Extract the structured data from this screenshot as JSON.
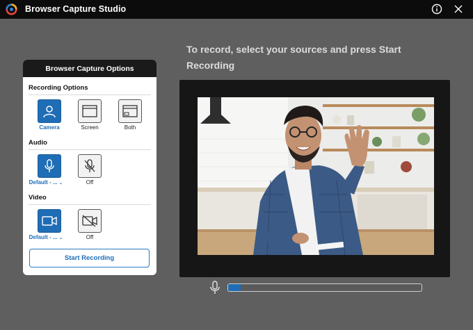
{
  "window": {
    "title": "Browser Capture Studio",
    "icons": {
      "logo": "app-logo-icon",
      "info": "info-icon",
      "close": "close-icon"
    }
  },
  "main": {
    "headline": "To record, select your sources and press Start Recording"
  },
  "panel": {
    "title": "Browser Capture Options",
    "recording": {
      "title": "Recording Options",
      "options": [
        {
          "label": "Camera",
          "selected": true,
          "icon": "camera-person-icon"
        },
        {
          "label": "Screen",
          "selected": false,
          "icon": "screen-window-icon"
        },
        {
          "label": "Both",
          "selected": false,
          "icon": "both-window-icon"
        }
      ]
    },
    "audio": {
      "title": "Audio",
      "options": [
        {
          "label": "Default - ...",
          "selected": true,
          "icon": "microphone-icon",
          "has_dropdown": true
        },
        {
          "label": "Off",
          "selected": false,
          "icon": "microphone-off-icon"
        }
      ]
    },
    "video": {
      "title": "Video",
      "options": [
        {
          "label": "Default - ...",
          "selected": true,
          "icon": "video-camera-icon",
          "has_dropdown": true
        },
        {
          "label": "Off",
          "selected": false,
          "icon": "video-off-icon"
        }
      ]
    },
    "start_button": "Start Recording"
  },
  "preview": {
    "audio_level": 0.065
  },
  "colors": {
    "accent": "#1f6db5",
    "background": "#5f5f5f",
    "titlebar": "#0c0c0c"
  }
}
